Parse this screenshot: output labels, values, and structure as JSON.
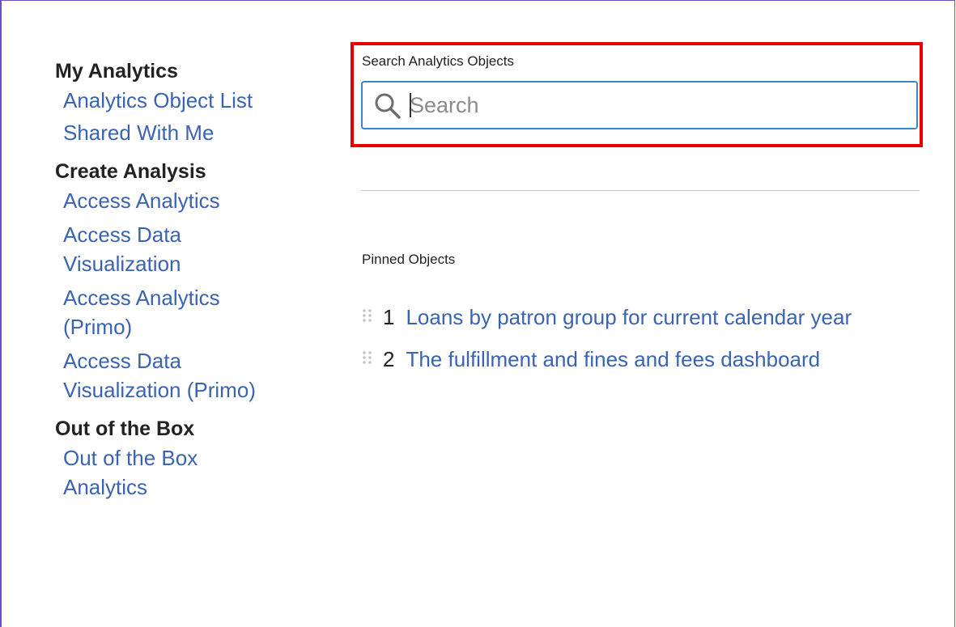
{
  "sidebar": {
    "sections": [
      {
        "title": "My Analytics",
        "items": [
          "Analytics Object List",
          "Shared With Me"
        ]
      },
      {
        "title": "Create Analysis",
        "items": [
          "Access Analytics",
          "Access Data Visualization",
          "Access Analytics (Primo)",
          "Access Data Visualization (Primo)"
        ]
      },
      {
        "title": "Out of the Box",
        "items": [
          "Out of the Box Analytics"
        ]
      }
    ]
  },
  "search": {
    "label": "Search Analytics Objects",
    "placeholder": "Search",
    "value": ""
  },
  "pinned": {
    "label": "Pinned Objects",
    "items": [
      {
        "number": "1",
        "title": "Loans by patron group for current calendar year"
      },
      {
        "number": "2",
        "title": "The fulfillment and fines and fees dashboard"
      }
    ]
  },
  "colors": {
    "link": "#3a63b3",
    "highlight_border": "#e80000",
    "input_border": "#3a86c8",
    "frame_border": "#6b4fc6"
  },
  "icons": {
    "search": "search-icon",
    "drag": "drag-handle-icon"
  }
}
